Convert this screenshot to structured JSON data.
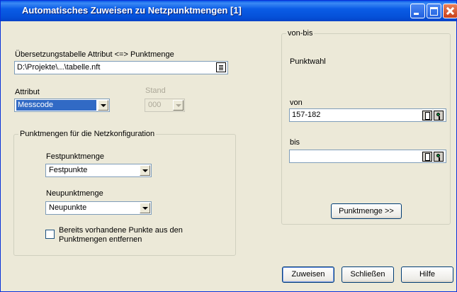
{
  "window": {
    "title": "Automatisches Zuweisen zu Netzpunktmengen [1]"
  },
  "left": {
    "table_label": "Übersetzungstabelle Attribut <=> Punktmenge",
    "table_value": "D:\\Projekte\\...\\tabelle.nft",
    "attribut_label": "Attribut",
    "attribut_value": "Messcode",
    "stand_label": "Stand",
    "stand_value": "000"
  },
  "group": {
    "title": "Punktmengen für die Netzkonfiguration",
    "fest_label": "Festpunktmenge",
    "fest_value": "Festpunkte",
    "neu_label": "Neupunktmenge",
    "neu_value": "Neupunkte",
    "checkbox_label_1": "Bereits vorhandene Punkte aus den",
    "checkbox_label_2": "Punktmengen entfernen",
    "checkbox_checked": false
  },
  "vonbis": {
    "title": "von-bis",
    "punktwahl": "Punktwahl",
    "von_label": "von",
    "von_value": "157-182",
    "bis_label": "bis",
    "bis_value": "",
    "punktmenge_button": "Punktmenge >>"
  },
  "buttons": {
    "zuweisen": "Zuweisen",
    "schliessen": "Schließen",
    "hilfe": "Hilfe"
  }
}
